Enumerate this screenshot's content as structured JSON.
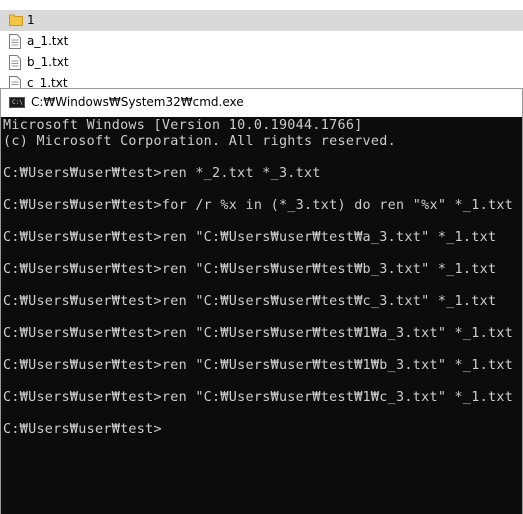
{
  "explorer": {
    "files": [
      {
        "name": "1",
        "type": "folder",
        "selected": true
      },
      {
        "name": "a_1.txt",
        "type": "text-file",
        "selected": false
      },
      {
        "name": "b_1.txt",
        "type": "text-file",
        "selected": false
      },
      {
        "name": "c_1.txt",
        "type": "text-file",
        "selected": false
      }
    ]
  },
  "cmd_window": {
    "icon_label": "C:\\",
    "title": "C:₩Windows₩System32₩cmd.exe",
    "lines": [
      "Microsoft Windows [Version 10.0.19044.1766]",
      "(c) Microsoft Corporation. All rights reserved.",
      "",
      "C:₩Users₩user₩test>ren *_2.txt *_3.txt",
      "",
      "C:₩Users₩user₩test>for /r %x in (*_3.txt) do ren \"%x\" *_1.txt",
      "",
      "C:₩Users₩user₩test>ren \"C:₩Users₩user₩test₩a_3.txt\" *_1.txt",
      "",
      "C:₩Users₩user₩test>ren \"C:₩Users₩user₩test₩b_3.txt\" *_1.txt",
      "",
      "C:₩Users₩user₩test>ren \"C:₩Users₩user₩test₩c_3.txt\" *_1.txt",
      "",
      "C:₩Users₩user₩test>ren \"C:₩Users₩user₩test₩1₩a_3.txt\" *_1.txt",
      "",
      "C:₩Users₩user₩test>ren \"C:₩Users₩user₩test₩1₩b_3.txt\" *_1.txt",
      "",
      "C:₩Users₩user₩test>ren \"C:₩Users₩user₩test₩1₩c_3.txt\" *_1.txt",
      "",
      "C:₩Users₩user₩test>"
    ]
  },
  "colors": {
    "console_bg": "#0c0c0c",
    "console_text": "#cccccc",
    "selected_row": "#d9d9d9",
    "folder": "#f4c542"
  }
}
